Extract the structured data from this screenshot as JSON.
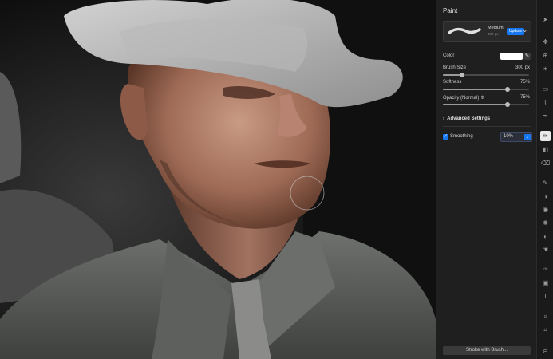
{
  "panel": {
    "title": "Paint",
    "preset": {
      "name": "Medium",
      "size": "300 px",
      "update_label": "Update"
    },
    "color_label": "Color",
    "brush_size": {
      "label": "Brush Size",
      "value": "300 px",
      "level_percent": 22
    },
    "softness": {
      "label": "Softness",
      "value": "75%",
      "level_percent": 75
    },
    "opacity": {
      "label": "Opacity (Normal)",
      "value": "75%",
      "level_percent": 75
    },
    "advanced_label": "Advanced Settings",
    "smoothing": {
      "label": "Smoothing",
      "value": "10%",
      "checked": true
    },
    "stroke_button": "Stroke with Brush..."
  },
  "colors": {
    "accent": "#1778f2",
    "panel_bg": "#1f1f1f",
    "swatch": "#ffffff"
  },
  "toolbar": {
    "tools": [
      "select-arrow-icon",
      "move-icon",
      "transform-icon",
      "magic-icon",
      "crop-frame-icon",
      "lasso-icon",
      "pen-icon",
      "brush-icon",
      "fill-bucket-icon",
      "eraser-icon",
      "pencil-icon",
      "gradient-icon",
      "blur-icon",
      "sharpen-icon",
      "dodge-icon",
      "clone-icon",
      "smudge-icon",
      "shape-icon",
      "text-icon",
      "zoom-icon",
      "crop-icon",
      "more-icon"
    ],
    "active": "brush-icon"
  }
}
